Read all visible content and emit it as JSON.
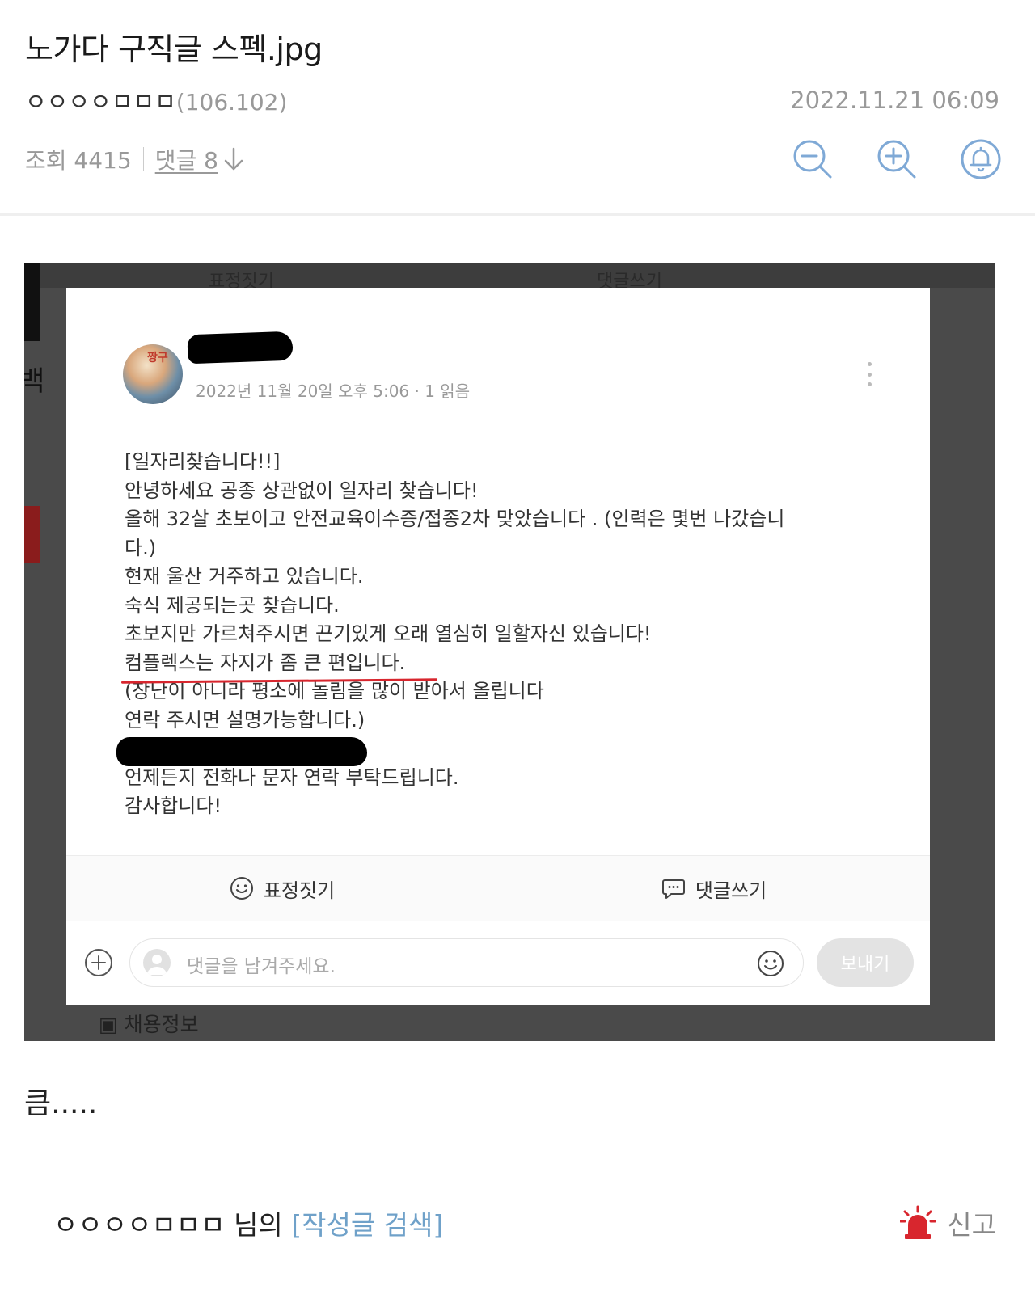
{
  "post": {
    "title": "노가다 구직글 스펙.jpg",
    "author": "ㅇㅇㅇㅇㅁㅁㅁ",
    "ip": "(106.102)",
    "date": "2022.11.21 06:09",
    "views": "조회 4415",
    "comments": "댓글 8",
    "body": "큼....."
  },
  "icons": {
    "zoom_out": "zoom-out-icon",
    "zoom_in": "zoom-in-icon",
    "bell": "bell-icon",
    "down_arrow": "arrow-down-icon",
    "siren": "siren-icon",
    "accent": "#7fa9d6",
    "siren_color": "#d8262e",
    "underline_color": "#d8262e"
  },
  "screenshot": {
    "bg_react_label": "표정짓기",
    "bg_comment_label": "댓글쓰기",
    "bg_side_char": "백",
    "bg_bottom_label": "▣ 채용정보",
    "card_meta": "2022년 11월 20일 오후 5:06 · 1 읽음",
    "avatar_text": "짱구",
    "lines": [
      "[일자리찾습니다!!]",
      "안녕하세요 공종 상관없이 일자리 찾습니다!",
      "올해 32살 초보이고 안전교육이수증/접종2차 맞았습니다 . (인력은 몇번 나갔습니",
      "다.)",
      "현재 울산 거주하고 있습니다.",
      "숙식 제공되는곳 찾습니다.",
      "초보지만 가르쳐주시면 끈기있게 오래 열심히 일할자신 있습니다!",
      "컴플렉스는 자지가 좀 큰 편입니다.",
      "(장난이 아니라 평소에 놀림을 많이 받아서 올립니다",
      "연락 주시면 설명가능합니다.)",
      "",
      "언제든지 전화나 문자 연락 부탁드립니다.",
      "감사합니다!"
    ],
    "react_label": "표정짓기",
    "comment_label": "댓글쓰기",
    "input_placeholder": "댓글을 남겨주세요.",
    "send_label": "보내기"
  },
  "footer": {
    "author": "ㅇㅇㅇㅇㅁㅁㅁ",
    "suffix": " 님의 ",
    "search_link": "[작성글 검색]",
    "report": "신고"
  }
}
